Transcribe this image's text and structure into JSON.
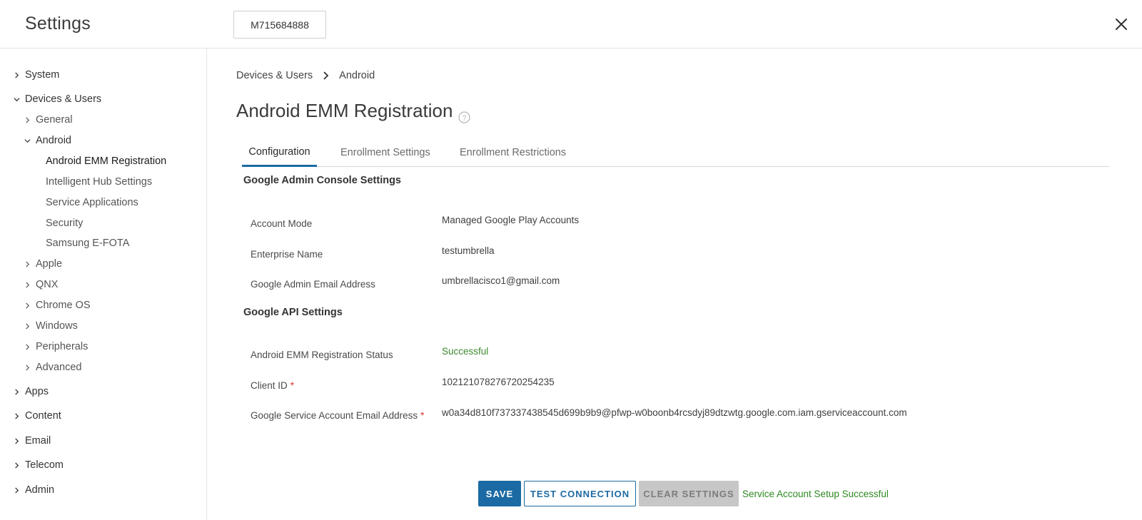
{
  "header": {
    "title": "Settings",
    "org_button": "M715684888",
    "close_icon": "close-icon"
  },
  "sidebar": {
    "items": [
      {
        "label": "System",
        "expanded": false
      },
      {
        "label": "Devices & Users",
        "expanded": true
      },
      {
        "label": "General",
        "expanded": false
      },
      {
        "label": "Android",
        "expanded": true
      },
      {
        "label": "Android EMM Registration",
        "active": true
      },
      {
        "label": "Intelligent Hub Settings"
      },
      {
        "label": "Service Applications"
      },
      {
        "label": "Security"
      },
      {
        "label": "Samsung E-FOTA"
      },
      {
        "label": "Apple",
        "expanded": false
      },
      {
        "label": "QNX",
        "expanded": false
      },
      {
        "label": "Chrome OS",
        "expanded": false
      },
      {
        "label": "Windows",
        "expanded": false
      },
      {
        "label": "Peripherals",
        "expanded": false
      },
      {
        "label": "Advanced",
        "expanded": false
      },
      {
        "label": "Apps",
        "expanded": false
      },
      {
        "label": "Content",
        "expanded": false
      },
      {
        "label": "Email",
        "expanded": false
      },
      {
        "label": "Telecom",
        "expanded": false
      },
      {
        "label": "Admin",
        "expanded": false
      }
    ]
  },
  "breadcrumb": [
    "Devices & Users",
    "Android"
  ],
  "page": {
    "title": "Android EMM Registration",
    "help_icon": "help-circle-icon"
  },
  "tabs": [
    {
      "label": "Configuration",
      "active": true
    },
    {
      "label": "Enrollment Settings",
      "active": false
    },
    {
      "label": "Enrollment Restrictions",
      "active": false
    }
  ],
  "sections": {
    "admin_console": {
      "title": "Google Admin Console Settings",
      "fields": [
        {
          "label": "Account Mode",
          "value": "Managed Google Play Accounts"
        },
        {
          "label": "Enterprise Name",
          "value": "testumbrella"
        },
        {
          "label": "Google Admin Email Address",
          "value": "umbrellacisco1@gmail.com"
        }
      ]
    },
    "api": {
      "title": "Google API Settings",
      "fields": [
        {
          "label": "Android EMM Registration Status",
          "value": "Successful"
        },
        {
          "label": "Client ID",
          "required_mark": "*",
          "value": "102121078276720254235"
        },
        {
          "label": "Google Service Account Email Address",
          "required_mark": "*",
          "value": "w0a34d810f737337438545d699b9b9@pfwp-w0boonb4rcsdyj89dtzwtg.google.com.iam.gserviceaccount.com"
        }
      ]
    }
  },
  "actions": {
    "save": "SAVE",
    "test_connection": "TEST CONNECTION",
    "clear_settings": "CLEAR SETTINGS",
    "status_message": "Service Account Setup Successful"
  },
  "colors": {
    "accent": "#1b6aa3",
    "success": "#3c8a2e",
    "required": "#d93025",
    "disabled_bg": "#c7c7c7"
  }
}
